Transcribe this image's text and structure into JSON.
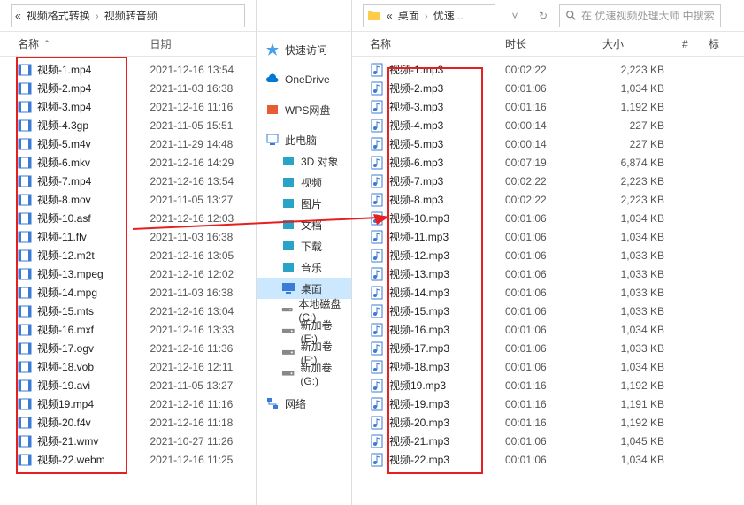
{
  "left": {
    "breadcrumb": [
      "视频格式转换",
      "视频转音频"
    ],
    "headers": {
      "name": "名称",
      "date": "日期"
    },
    "files": [
      {
        "name": "视频-1.mp4",
        "date": "2021-12-16 13:54"
      },
      {
        "name": "视频-2.mp4",
        "date": "2021-11-03 16:38"
      },
      {
        "name": "视频-3.mp4",
        "date": "2021-12-16 11:16"
      },
      {
        "name": "视频-4.3gp",
        "date": "2021-11-05 15:51"
      },
      {
        "name": "视频-5.m4v",
        "date": "2021-11-29 14:48"
      },
      {
        "name": "视频-6.mkv",
        "date": "2021-12-16 14:29"
      },
      {
        "name": "视频-7.mp4",
        "date": "2021-12-16 13:54"
      },
      {
        "name": "视频-8.mov",
        "date": "2021-11-05 13:27"
      },
      {
        "name": "视频-10.asf",
        "date": "2021-12-16 12:03"
      },
      {
        "name": "视频-11.flv",
        "date": "2021-11-03 16:38"
      },
      {
        "name": "视频-12.m2t",
        "date": "2021-12-16 13:05"
      },
      {
        "name": "视频-13.mpeg",
        "date": "2021-12-16 12:02"
      },
      {
        "name": "视频-14.mpg",
        "date": "2021-11-03 16:38"
      },
      {
        "name": "视频-15.mts",
        "date": "2021-12-16 13:04"
      },
      {
        "name": "视频-16.mxf",
        "date": "2021-12-16 13:33"
      },
      {
        "name": "视频-17.ogv",
        "date": "2021-12-16 11:36"
      },
      {
        "name": "视频-18.vob",
        "date": "2021-12-16 12:11"
      },
      {
        "name": "视频-19.avi",
        "date": "2021-11-05 13:27"
      },
      {
        "name": "视频19.mp4",
        "date": "2021-12-16 11:16"
      },
      {
        "name": "视频-20.f4v",
        "date": "2021-12-16 11:18"
      },
      {
        "name": "视频-21.wmv",
        "date": "2021-10-27 11:26"
      },
      {
        "name": "视频-22.webm",
        "date": "2021-12-16 11:25"
      }
    ]
  },
  "nav": {
    "items": [
      {
        "label": "快速访问",
        "icon": "star",
        "sep": false
      },
      {
        "sep": true
      },
      {
        "label": "OneDrive",
        "icon": "cloud",
        "sep": false
      },
      {
        "sep": true
      },
      {
        "label": "WPS网盘",
        "icon": "wps",
        "sep": false
      },
      {
        "sep": true
      },
      {
        "label": "此电脑",
        "icon": "pc",
        "sep": false
      },
      {
        "label": "3D 对象",
        "icon": "3d",
        "indent": true
      },
      {
        "label": "视频",
        "icon": "video",
        "indent": true
      },
      {
        "label": "图片",
        "icon": "picture",
        "indent": true
      },
      {
        "label": "文档",
        "icon": "doc",
        "indent": true
      },
      {
        "label": "下载",
        "icon": "download",
        "indent": true
      },
      {
        "label": "音乐",
        "icon": "music",
        "indent": true
      },
      {
        "label": "桌面",
        "icon": "desktop",
        "indent": true,
        "selected": true
      },
      {
        "label": "本地磁盘 (C:)",
        "icon": "drive",
        "indent": true
      },
      {
        "label": "新加卷 (E:)",
        "icon": "drive",
        "indent": true
      },
      {
        "label": "新加卷 (F:)",
        "icon": "drive",
        "indent": true
      },
      {
        "label": "新加卷 (G:)",
        "icon": "drive",
        "indent": true
      },
      {
        "sep": true
      },
      {
        "label": "网络",
        "icon": "network",
        "sep": false
      }
    ]
  },
  "right": {
    "breadcrumb": [
      "桌面",
      "优速..."
    ],
    "search_placeholder": "在 优速视频处理大师 中搜索",
    "headers": {
      "name": "名称",
      "duration": "时长",
      "size": "大小",
      "idx": "#",
      "title": "标"
    },
    "files": [
      {
        "name": "视频-1.mp3",
        "dur": "00:02:22",
        "size": "2,223 KB"
      },
      {
        "name": "视频-2.mp3",
        "dur": "00:01:06",
        "size": "1,034 KB"
      },
      {
        "name": "视频-3.mp3",
        "dur": "00:01:16",
        "size": "1,192 KB"
      },
      {
        "name": "视频-4.mp3",
        "dur": "00:00:14",
        "size": "227 KB"
      },
      {
        "name": "视频-5.mp3",
        "dur": "00:00:14",
        "size": "227 KB"
      },
      {
        "name": "视频-6.mp3",
        "dur": "00:07:19",
        "size": "6,874 KB"
      },
      {
        "name": "视频-7.mp3",
        "dur": "00:02:22",
        "size": "2,223 KB"
      },
      {
        "name": "视频-8.mp3",
        "dur": "00:02:22",
        "size": "2,223 KB"
      },
      {
        "name": "视频-10.mp3",
        "dur": "00:01:06",
        "size": "1,034 KB"
      },
      {
        "name": "视频-11.mp3",
        "dur": "00:01:06",
        "size": "1,034 KB"
      },
      {
        "name": "视频-12.mp3",
        "dur": "00:01:06",
        "size": "1,033 KB"
      },
      {
        "name": "视频-13.mp3",
        "dur": "00:01:06",
        "size": "1,033 KB"
      },
      {
        "name": "视频-14.mp3",
        "dur": "00:01:06",
        "size": "1,033 KB"
      },
      {
        "name": "视频-15.mp3",
        "dur": "00:01:06",
        "size": "1,033 KB"
      },
      {
        "name": "视频-16.mp3",
        "dur": "00:01:06",
        "size": "1,034 KB"
      },
      {
        "name": "视频-17.mp3",
        "dur": "00:01:06",
        "size": "1,033 KB"
      },
      {
        "name": "视频-18.mp3",
        "dur": "00:01:06",
        "size": "1,034 KB"
      },
      {
        "name": "视频19.mp3",
        "dur": "00:01:16",
        "size": "1,192 KB"
      },
      {
        "name": "视频-19.mp3",
        "dur": "00:01:16",
        "size": "1,191 KB"
      },
      {
        "name": "视频-20.mp3",
        "dur": "00:01:16",
        "size": "1,192 KB"
      },
      {
        "name": "视频-21.mp3",
        "dur": "00:01:06",
        "size": "1,045 KB"
      },
      {
        "name": "视频-22.mp3",
        "dur": "00:01:06",
        "size": "1,034 KB"
      }
    ]
  },
  "icons": {
    "video": "#3a7bd5",
    "audio": "#3a7bd5",
    "folder": "#ffcb4b",
    "star_color": "#4aa0e6"
  }
}
